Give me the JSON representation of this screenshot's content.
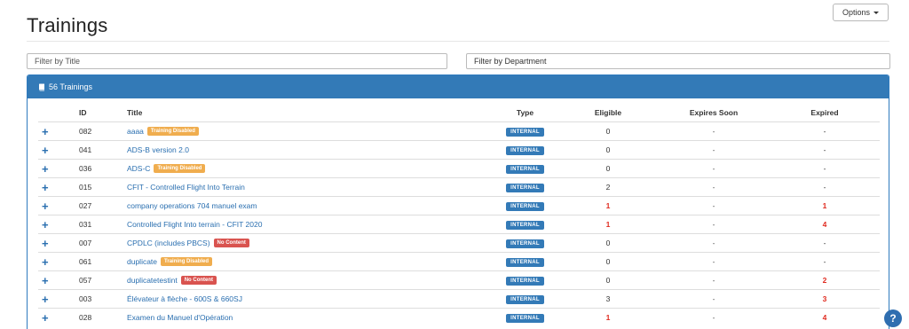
{
  "page": {
    "title": "Trainings"
  },
  "options": {
    "label": "Options"
  },
  "filters": {
    "title_placeholder": "Filter by Title",
    "department_placeholder": "Filter by Department"
  },
  "panel": {
    "heading": "56 Trainings"
  },
  "table": {
    "headers": {
      "id": "ID",
      "title": "Title",
      "type": "Type",
      "eligible": "Eligible",
      "expires_soon": "Expires Soon",
      "expired": "Expired"
    },
    "rows": [
      {
        "id": "082",
        "title": "aaaa",
        "badge": "Training Disabled",
        "badge_kind": "warn",
        "type": "INTERNAL",
        "eligible": "0",
        "eligible_red": false,
        "expires_soon": "-",
        "expired": "-",
        "expired_red": false
      },
      {
        "id": "041",
        "title": "ADS-B version 2.0",
        "badge": "",
        "badge_kind": "",
        "type": "INTERNAL",
        "eligible": "0",
        "eligible_red": false,
        "expires_soon": "-",
        "expired": "-",
        "expired_red": false
      },
      {
        "id": "036",
        "title": "ADS-C",
        "badge": "Training Disabled",
        "badge_kind": "warn",
        "type": "INTERNAL",
        "eligible": "0",
        "eligible_red": false,
        "expires_soon": "-",
        "expired": "-",
        "expired_red": false
      },
      {
        "id": "015",
        "title": "CFIT - Controlled Flight Into Terrain",
        "badge": "",
        "badge_kind": "",
        "type": "INTERNAL",
        "eligible": "2",
        "eligible_red": false,
        "expires_soon": "-",
        "expired": "-",
        "expired_red": false
      },
      {
        "id": "027",
        "title": "company operations 704 manuel exam",
        "badge": "",
        "badge_kind": "",
        "type": "INTERNAL",
        "eligible": "1",
        "eligible_red": true,
        "expires_soon": "-",
        "expired": "1",
        "expired_red": true
      },
      {
        "id": "031",
        "title": "Controlled Flight Into terrain - CFIT 2020",
        "badge": "",
        "badge_kind": "",
        "type": "INTERNAL",
        "eligible": "1",
        "eligible_red": true,
        "expires_soon": "-",
        "expired": "4",
        "expired_red": true
      },
      {
        "id": "007",
        "title": "CPDLC (includes PBCS)",
        "badge": "No Content",
        "badge_kind": "danger",
        "type": "INTERNAL",
        "eligible": "0",
        "eligible_red": false,
        "expires_soon": "-",
        "expired": "-",
        "expired_red": false
      },
      {
        "id": "061",
        "title": "duplicate",
        "badge": "Training Disabled",
        "badge_kind": "warn",
        "type": "INTERNAL",
        "eligible": "0",
        "eligible_red": false,
        "expires_soon": "-",
        "expired": "-",
        "expired_red": false
      },
      {
        "id": "057",
        "title": "duplicatetestint",
        "badge": "No Content",
        "badge_kind": "danger",
        "type": "INTERNAL",
        "eligible": "0",
        "eligible_red": false,
        "expires_soon": "-",
        "expired": "2",
        "expired_red": true
      },
      {
        "id": "003",
        "title": "Élévateur à flèche - 600S & 660SJ",
        "badge": "",
        "badge_kind": "",
        "type": "INTERNAL",
        "eligible": "3",
        "eligible_red": false,
        "expires_soon": "-",
        "expired": "3",
        "expired_red": true
      },
      {
        "id": "028",
        "title": "Examen du Manuel d'Opération",
        "badge": "",
        "badge_kind": "",
        "type": "INTERNAL",
        "eligible": "1",
        "eligible_red": true,
        "expires_soon": "-",
        "expired": "4",
        "expired_red": true
      }
    ]
  },
  "help": {
    "label": "?"
  },
  "icons": {
    "expand": "plus-icon",
    "panel": "book-icon",
    "options": "caret-down-icon",
    "help": "help-icon"
  },
  "colors": {
    "primary": "#337ab7",
    "warning": "#f0ad4e",
    "danger": "#d9534f",
    "alert_text": "#e02b20"
  }
}
